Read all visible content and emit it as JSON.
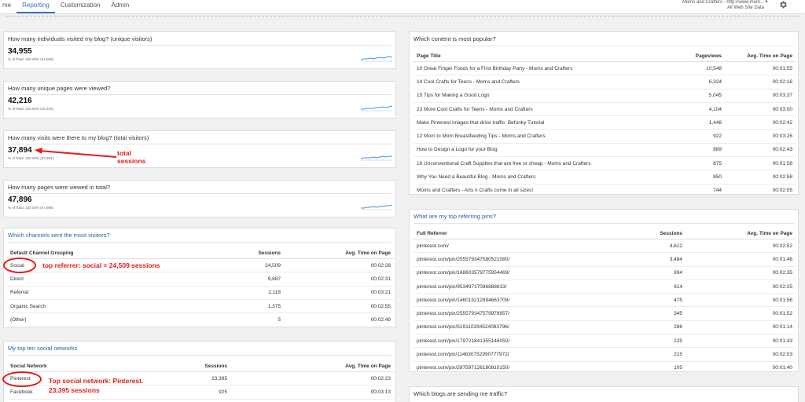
{
  "nav": {
    "tabs": [
      "me",
      "Reporting",
      "Customization",
      "Admin"
    ],
    "active": 1
  },
  "account": {
    "line1": "Moms and Crafters - http://www.mom...",
    "line2": "All Web Site Data",
    "dropdown": "▼"
  },
  "cards": [
    {
      "question": "How many individuals visited my blog? (unique visitors)",
      "value": "34,955",
      "pct": "% of Total: 100.00% (34,955)"
    },
    {
      "question": "How many unique pages were viewed?",
      "value": "42,216",
      "pct": "% of Total: 100.00% (42,216)"
    },
    {
      "question": "How many visits were there to my blog? (total visitors)",
      "value": "37,894",
      "pct": "% of Total: 100.00% (37,894)"
    },
    {
      "question": "How many pages were viewed in total?",
      "value": "47,896",
      "pct": "% of Total: 100.00% (47,896)"
    }
  ],
  "channels": {
    "title": "Which channels sent the most visitors?",
    "headers": [
      "Default Channel Grouping",
      "Sessions",
      "Avg. Time on Page"
    ],
    "rows": [
      [
        "Social",
        "24,509",
        "00:02:28"
      ],
      [
        "Direct",
        "9,887",
        "00:02:31"
      ],
      [
        "Referral",
        "2,118",
        "00:03:21"
      ],
      [
        "Organic Search",
        "1,375",
        "00:02:55"
      ],
      [
        "(Other)",
        "5",
        "00:02:49"
      ]
    ]
  },
  "social": {
    "title": "My top ten social networks",
    "headers": [
      "Social Network",
      "Sessions",
      "Avg. Time on Page"
    ],
    "rows": [
      [
        "Pinterest",
        "23,395",
        "00:02:23"
      ],
      [
        "Facebook",
        "925",
        "00:03:13"
      ]
    ]
  },
  "popular": {
    "title": "Which content is most popular?",
    "headers": [
      "Page Title",
      "Pageviews",
      "Avg. Time on Page"
    ],
    "rows": [
      [
        "10 Great Finger Foods for a First Birthday Party - Moms and Crafters",
        "10,548",
        "00:01:55"
      ],
      [
        "14 Cool Crafts for Teens - Moms and Crafters",
        "6,324",
        "00:02:16"
      ],
      [
        "15 Tips for Making a Good Logo",
        "5,045",
        "00:03:37"
      ],
      [
        "23 More Cool Crafts for Teens - Moms and Crafters",
        "4,104",
        "00:03:00"
      ],
      [
        "Make Pinterest images that drive traffic: Befunky Tutorial",
        "1,446",
        "00:02:42"
      ],
      [
        "12 Mom to Mom Breastfeeding Tips - Moms and Crafters",
        "922",
        "00:03:26"
      ],
      [
        "How to Design a Logo for your Blog",
        "889",
        "00:02:43"
      ],
      [
        "16 Unconventional Craft Supplies that are free or cheap - Moms and Crafters",
        "875",
        "00:01:58"
      ],
      [
        "Why You Need a Beautiful Blog - Moms and Crafters",
        "850",
        "00:02:58"
      ],
      [
        "Moms and Crafters - Arts n Crafts come in all sizes!",
        "744",
        "00:02:05"
      ]
    ]
  },
  "pins": {
    "title": "What are my top referring pins?",
    "headers": [
      "Full Referrer",
      "Sessions",
      "Avg. Time on Page"
    ],
    "rows": [
      [
        "pinterest.com/",
        "4,612",
        "00:02:52"
      ],
      [
        "pinterest.com/pin/255579347580521080/",
        "3,484",
        "00:01:46"
      ],
      [
        "pinterest.com/pin/168603579775954469/",
        "994",
        "00:02:35"
      ],
      [
        "pinterest.com/pin/95349717086888633/",
        "614",
        "00:02:25"
      ],
      [
        "pinterest.com/pin/146015212894663709/",
        "475",
        "00:01:56"
      ],
      [
        "pinterest.com/pin/255579347579978957/",
        "345",
        "00:01:52"
      ],
      [
        "pinterest.com/pin/519110294524083796/",
        "286",
        "00:01:14"
      ],
      [
        "pinterest.com/pin/179721841355146050/",
        "225",
        "00:01:43"
      ],
      [
        "pinterest.com/pin/114630752990777972/",
        "215",
        "00:02:03"
      ],
      [
        "pinterest.com/pin/287597126180810150/",
        "105",
        "00:01:40"
      ]
    ]
  },
  "blogs": {
    "title": "Which blogs are sending me traffic?"
  },
  "annotations": {
    "total_sessions_1": "total",
    "total_sessions_2": "sessions",
    "top_referrer": "top referrer: social = 24,509 sessions",
    "top_social_1": "Top social network: Pinterest.",
    "top_social_2": "23,395 sessions"
  },
  "colors": {
    "accent": "#3b72c8",
    "annotation": "#e31b1b",
    "spark": "#4a8fd8"
  }
}
